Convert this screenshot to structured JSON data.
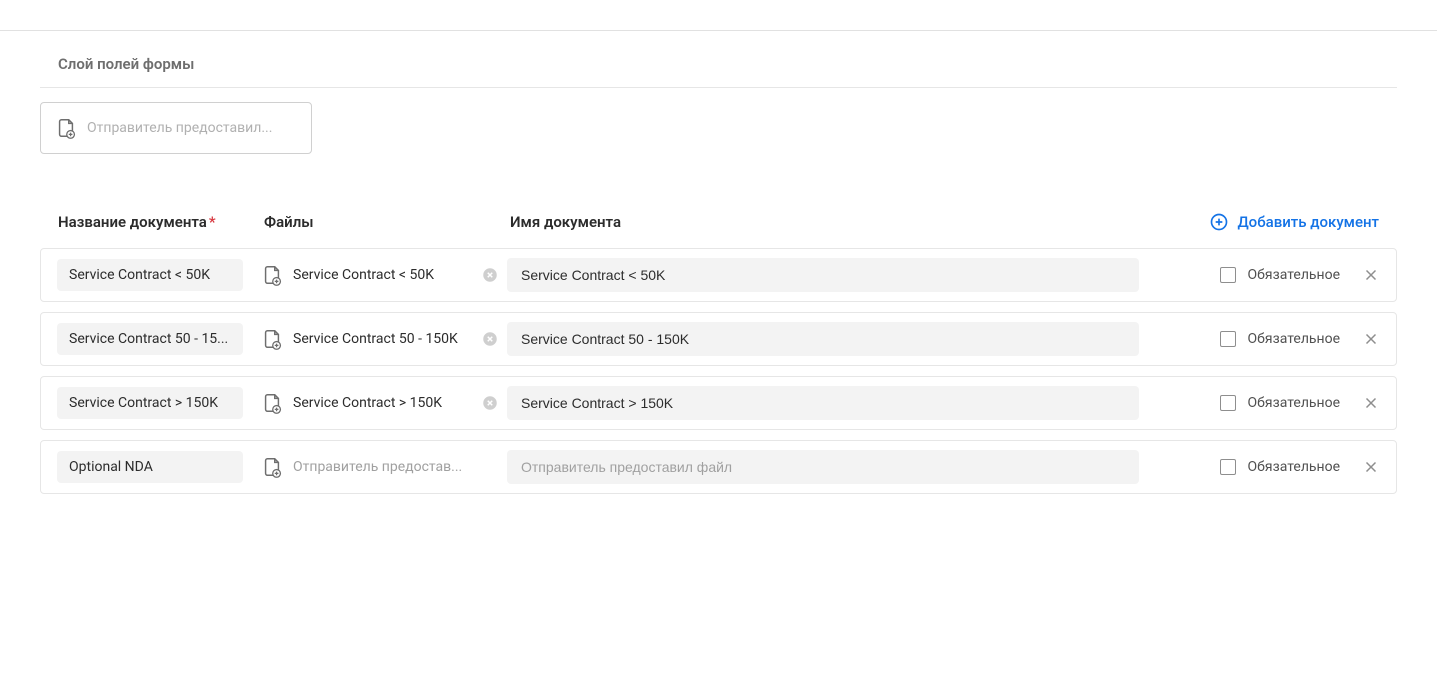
{
  "section_title": "Слой полей формы",
  "layer_placeholder": "Отправитель предоставил...",
  "columns": {
    "name": "Название документа",
    "files": "Файлы",
    "docname": "Имя документа",
    "add": "Добавить документ"
  },
  "required_marker": "*",
  "obligatory_label": "Обязательное",
  "file_placeholder": "Отправитель предостав...",
  "docname_placeholder": "Отправитель предоставил файл",
  "rows": [
    {
      "name": "Service Contract < 50K",
      "file": "Service Contract < 50K",
      "docname": "Service Contract < 50K",
      "has_file": true
    },
    {
      "name": "Service Contract 50 - 15...",
      "file": "Service Contract 50 - 150K",
      "docname": "Service Contract 50 - 150K",
      "has_file": true
    },
    {
      "name": "Service Contract > 150K",
      "file": "Service Contract > 150K",
      "docname": "Service Contract > 150K",
      "has_file": true
    },
    {
      "name": "Optional NDA",
      "file": "",
      "docname": "",
      "has_file": false
    }
  ]
}
